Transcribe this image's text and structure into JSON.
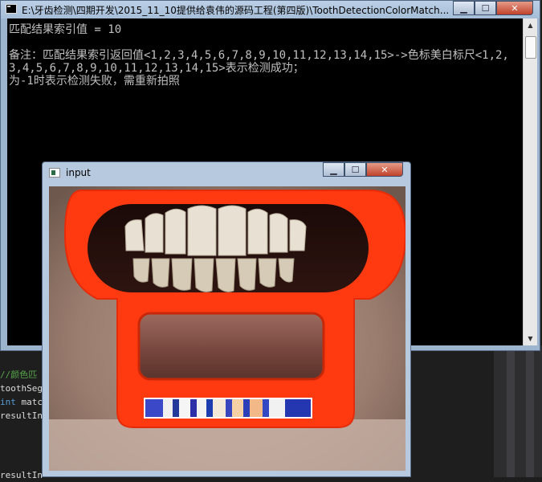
{
  "console": {
    "title": "E:\\牙齿检测\\四期开发\\2015_11_10提供给袁伟的源码工程(第四版)\\ToothDetectionColorMatch...",
    "lines": [
      "匹配结果索引值 = 10",
      "",
      "备注：匹配结果索引返回值<1,2,3,4,5,6,7,8,9,10,11,12,13,14,15>->色标美白标尺<1,2,",
      "3,4,5,6,7,8,9,10,11,12,13,14,15>表示检测成功；",
      "为-1时表示检测失败，需重新拍照"
    ]
  },
  "input_window": {
    "title": "input"
  },
  "ide_code": {
    "line1": "//颜色匹",
    "line2": "toothSeg",
    "line3_kw": "int",
    "line3_rest": " matc",
    "line4": "resultIn",
    "line5": "resultIn"
  },
  "controls": {
    "min": "▁",
    "max": "☐",
    "close": "✕"
  },
  "colors": {
    "console_bg": "#000000",
    "console_text": "#c0c0c0",
    "frame_blue": "#9db4cf",
    "device_orange": "#ff3a10"
  }
}
